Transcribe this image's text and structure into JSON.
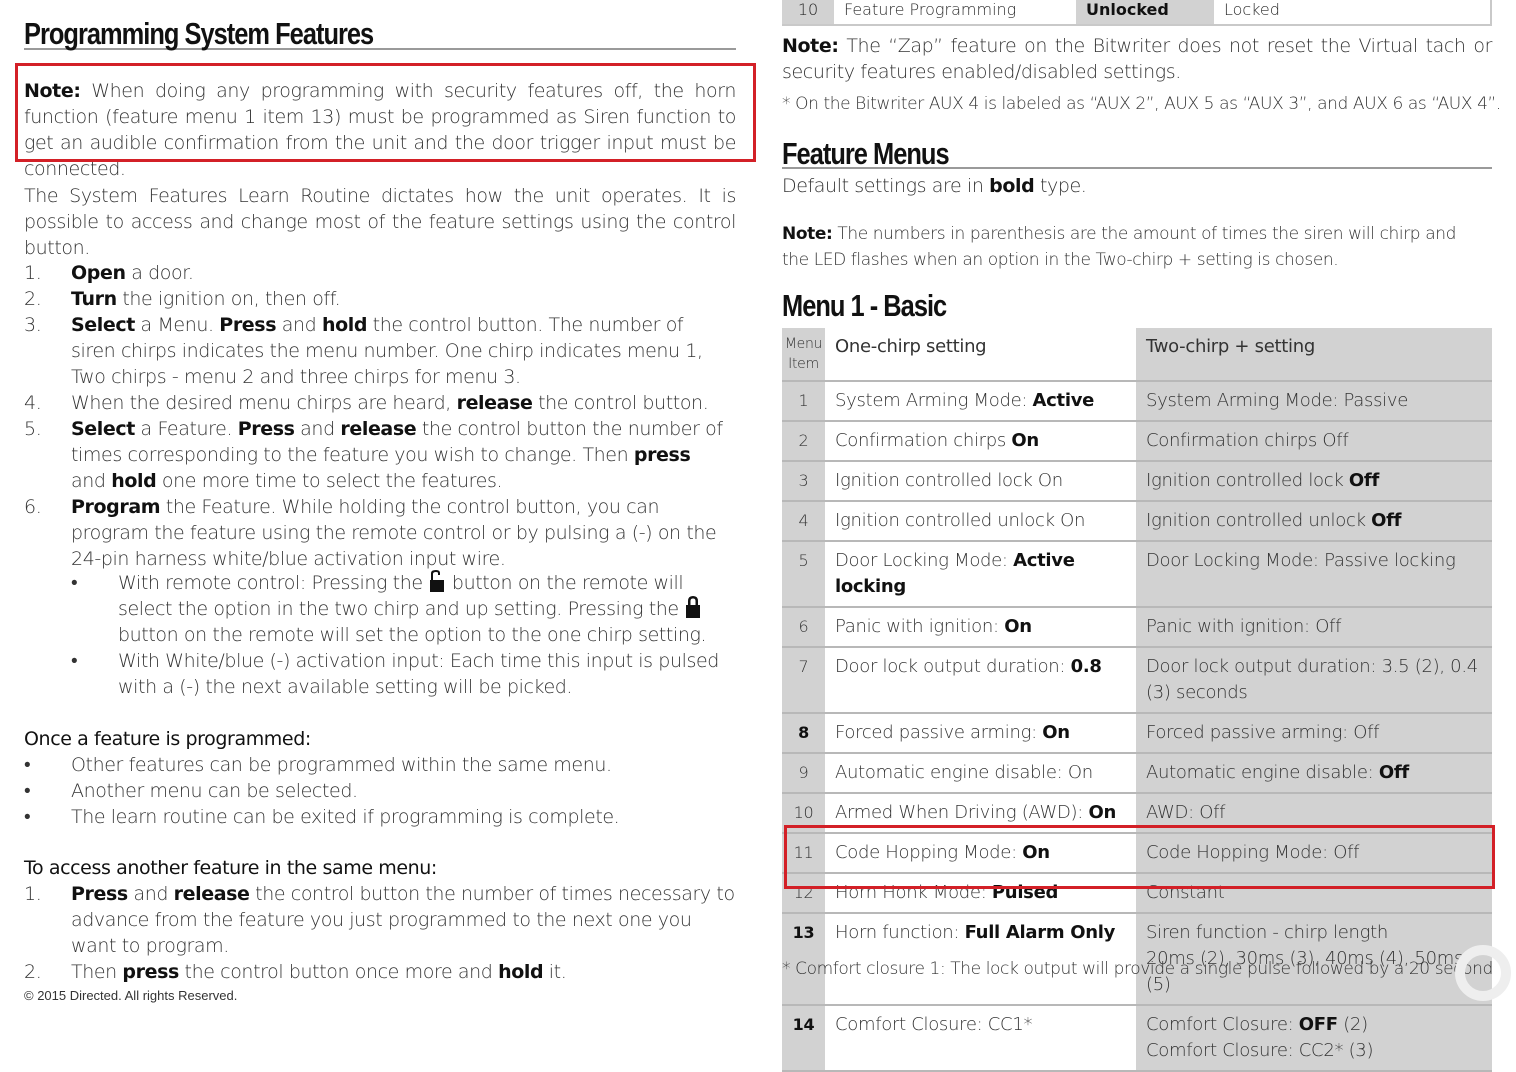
{
  "left": {
    "title": "Programming System Features",
    "note": {
      "label": "Note:",
      "text": " When doing any programming with security features off, the horn function (feature menu 1 item 13) must be programmed as Siren function to get an audible confirmation from the unit and the door trigger input must be connected."
    },
    "intro": "The System Features Learn Routine dictates how the unit operates. It is possible to access and change most of the feature settings using the control button.",
    "steps": [
      {
        "num": "1.",
        "parts": [
          [
            "b",
            "Open"
          ],
          [
            "t",
            " a door."
          ]
        ]
      },
      {
        "num": "2.",
        "parts": [
          [
            "b",
            "Turn"
          ],
          [
            "t",
            " the ignition on, then off."
          ]
        ]
      },
      {
        "num": "3.",
        "parts": [
          [
            "b",
            "Select"
          ],
          [
            "t",
            " a Menu. "
          ],
          [
            "b",
            "Press"
          ],
          [
            "t",
            " and "
          ],
          [
            "b",
            "hold"
          ],
          [
            "t",
            " the control button. The number of siren chirps indicates the menu number. One chirp indicates menu 1, Two chirps - menu 2 and three chirps for menu 3."
          ]
        ]
      },
      {
        "num": "4.",
        "parts": [
          [
            "t",
            "When the desired menu chirps are heard, "
          ],
          [
            "b",
            "release"
          ],
          [
            "t",
            " the control button."
          ]
        ]
      },
      {
        "num": "5.",
        "parts": [
          [
            "b",
            "Select"
          ],
          [
            "t",
            " a Feature. "
          ],
          [
            "b",
            "Press"
          ],
          [
            "t",
            " and "
          ],
          [
            "b",
            "release"
          ],
          [
            "t",
            " the control button the number of times corresponding to the feature you wish to change. Then "
          ],
          [
            "b",
            "press"
          ],
          [
            "t",
            " and "
          ],
          [
            "b",
            "hold"
          ],
          [
            "t",
            " one more time to select the features."
          ]
        ]
      },
      {
        "num": "6.",
        "parts": [
          [
            "b",
            "Program"
          ],
          [
            "t",
            " the Feature. While holding the control button, you can program the feature using the remote control or by pulsing a (-) on the 24-pin harness white/blue activation input wire."
          ]
        ]
      }
    ],
    "step6_bullets": {
      "remote_a": "With remote control: Pressing the ",
      "remote_b": " button on the remote will select the option in the two chirp and up setting. Pressing the ",
      "remote_c": " button on the remote will set the option to the one chirp setting.",
      "input": "With White/blue (-) activation input: Each time this input is pulsed with a (-) the next available setting will be picked.",
      "unlock_icon": "unlock-icon",
      "lock_icon": "lock-icon"
    },
    "once_heading": "Once a feature is programmed:",
    "once_items": [
      "Other features can be programmed within the same menu.",
      "Another menu can be selected.",
      "The learn routine can be exited if programming is complete."
    ],
    "access_heading": "To access another feature in the same menu:",
    "access_steps": [
      {
        "num": "1.",
        "parts": [
          [
            "b",
            "Press"
          ],
          [
            "t",
            " and "
          ],
          [
            "b",
            "release"
          ],
          [
            "t",
            " the control button the number of times necessary to advance from the feature you just programmed to the next one you want to program."
          ]
        ]
      },
      {
        "num": "2.",
        "parts": [
          [
            "t",
            "Then "
          ],
          [
            "b",
            "press"
          ],
          [
            "t",
            " the control button once more and "
          ],
          [
            "b",
            "hold"
          ],
          [
            "t",
            " it."
          ]
        ]
      }
    ],
    "footer": "© 2015 Directed. All rights Reserved."
  },
  "right": {
    "top_row": {
      "num": "10",
      "feature": "Feature Programming",
      "default": "Unlocked",
      "alt": "Locked"
    },
    "zap_note": {
      "label": "Note:",
      "text": " The “Zap” feature on the Bitwriter does not reset the Virtual tach or security features enabled/disabled settings."
    },
    "aux_note": "*  On the Bitwriter AUX 4 is labeled as “AUX 2”, AUX 5 as “AUX 3”, and AUX 6 as “AUX 4”.",
    "feature_menus_title": "Feature Menus",
    "default_note_a": "Default settings are in ",
    "default_note_b": "bold",
    "default_note_c": " type.",
    "paren_note": {
      "label": "Note:",
      "text": " The numbers in parenthesis are the amount of times the siren will chirp and the LED flashes when an option in the Two-chirp + setting is chosen."
    },
    "menu_title": "Menu 1 - Basic",
    "table": {
      "headers": {
        "num": "Menu Item",
        "one": "One-chirp setting",
        "two": "Two-chirp + setting"
      },
      "rows": [
        {
          "num": "1",
          "one": [
            [
              "t",
              "System Arming Mode: "
            ],
            [
              "b",
              "Active"
            ]
          ],
          "two": [
            [
              "t",
              "System Arming Mode: Passive"
            ]
          ]
        },
        {
          "num": "2",
          "one": [
            [
              "t",
              "Confirmation chirps "
            ],
            [
              "b",
              "On"
            ]
          ],
          "two": [
            [
              "t",
              "Confirmation chirps Off"
            ]
          ]
        },
        {
          "num": "3",
          "one": [
            [
              "t",
              "Ignition controlled lock On"
            ]
          ],
          "two": [
            [
              "t",
              "Ignition controlled lock "
            ],
            [
              "b",
              "Off"
            ]
          ]
        },
        {
          "num": "4",
          "one": [
            [
              "t",
              "Ignition controlled unlock On"
            ]
          ],
          "two": [
            [
              "t",
              "Ignition controlled unlock "
            ],
            [
              "b",
              "Off"
            ]
          ]
        },
        {
          "num": "5",
          "one": [
            [
              "t",
              "Door Locking Mode: "
            ],
            [
              "b",
              "Active locking"
            ]
          ],
          "two": [
            [
              "t",
              "Door Locking Mode: Passive locking"
            ]
          ]
        },
        {
          "num": "6",
          "one": [
            [
              "t",
              "Panic with ignition: "
            ],
            [
              "b",
              "On"
            ]
          ],
          "two": [
            [
              "t",
              "Panic with ignition: Off"
            ]
          ]
        },
        {
          "num": "7",
          "one": [
            [
              "t",
              "Door lock output duration: "
            ],
            [
              "b",
              "0.8"
            ]
          ],
          "two": [
            [
              "t",
              "Door lock output duration: 3.5 (2), 0.4 (3) seconds"
            ]
          ]
        },
        {
          "num": "8",
          "bold_num": true,
          "one": [
            [
              "t",
              "Forced passive arming: "
            ],
            [
              "b",
              "On"
            ]
          ],
          "two": [
            [
              "t",
              "Forced passive arming: Off"
            ]
          ]
        },
        {
          "num": "9",
          "one": [
            [
              "t",
              "Automatic engine disable: On"
            ]
          ],
          "two": [
            [
              "t",
              "Automatic engine disable: "
            ],
            [
              "b",
              "Off"
            ]
          ]
        },
        {
          "num": "10",
          "one": [
            [
              "t",
              "Armed When Driving (AWD): "
            ],
            [
              "b",
              "On"
            ]
          ],
          "two": [
            [
              "t",
              "AWD: Off"
            ]
          ]
        },
        {
          "num": "11",
          "one": [
            [
              "t",
              "Code Hopping Mode: "
            ],
            [
              "b",
              "On"
            ]
          ],
          "two": [
            [
              "t",
              "Code Hopping Mode: Off"
            ]
          ]
        },
        {
          "num": "12",
          "one": [
            [
              "t",
              "Horn Honk Mode: "
            ],
            [
              "b",
              "Pulsed"
            ]
          ],
          "two": [
            [
              "t",
              "Constant"
            ]
          ]
        },
        {
          "num": "13",
          "bold_num": true,
          "highlighted": true,
          "one": [
            [
              "t",
              "Horn function: "
            ],
            [
              "b",
              "Full Alarm Only"
            ]
          ],
          "two": [
            [
              "t",
              "Siren function - chirp length"
            ],
            [
              "br",
              ""
            ],
            [
              "t",
              "20ms (2), 30ms (3), 40ms (4), 50ms (5)"
            ]
          ]
        },
        {
          "num": "14",
          "bold_num": true,
          "one": [
            [
              "t",
              "Comfort Closure: CC1*"
            ]
          ],
          "two": [
            [
              "t",
              "Comfort Closure: "
            ],
            [
              "b",
              "OFF"
            ],
            [
              "t",
              " (2)"
            ],
            [
              "br",
              ""
            ],
            [
              "t",
              "Comfort Closure: CC2* (3)"
            ]
          ]
        }
      ]
    },
    "footnote": "*  Comfort closure 1: The lock output will provide a single pulse followed by a 20 second"
  },
  "colors": {
    "highlight_border": "#d32027",
    "table_gray": "#d2d2d2"
  }
}
